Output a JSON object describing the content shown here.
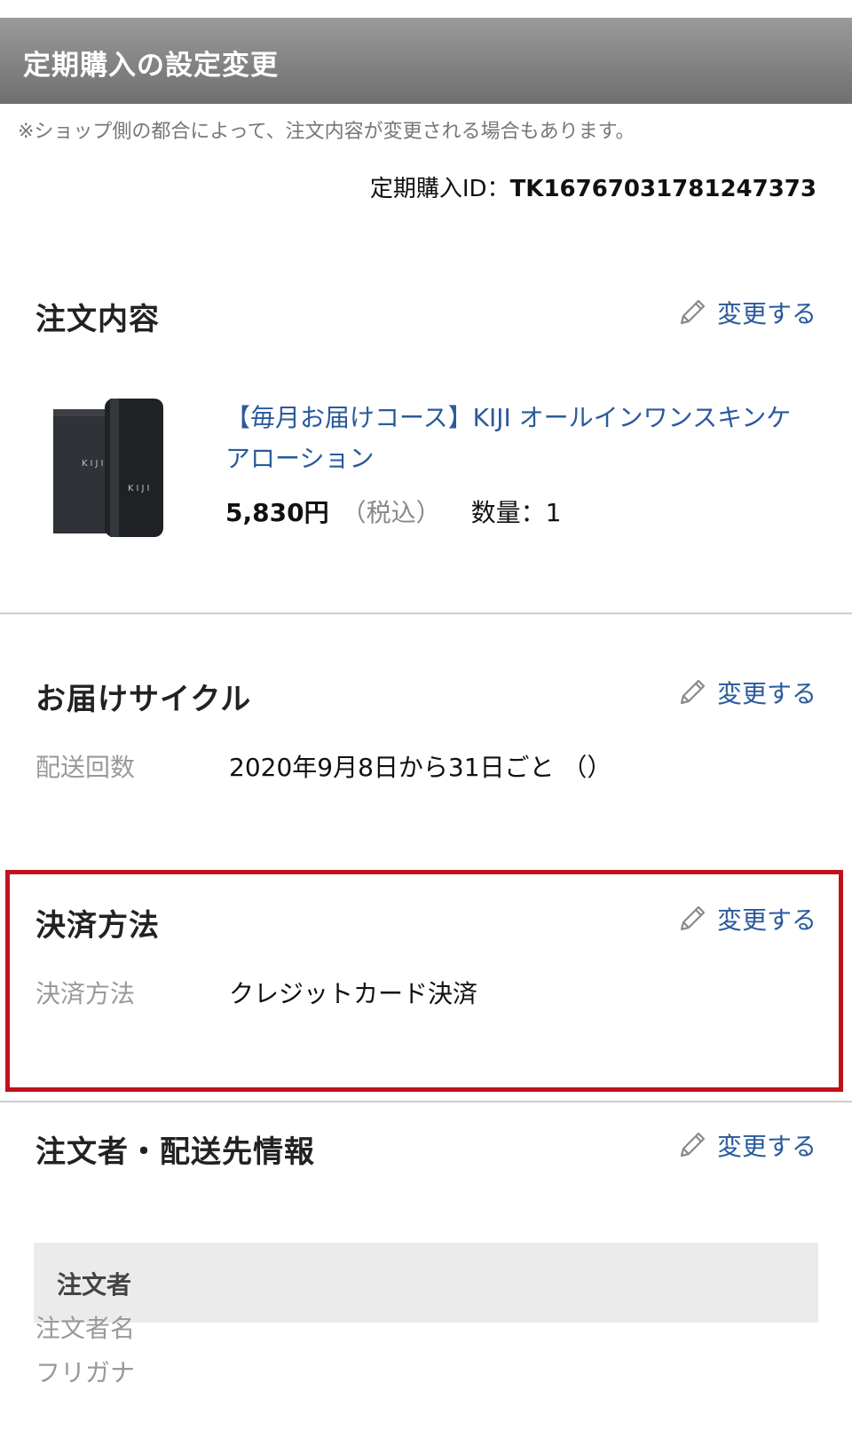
{
  "header": {
    "title": "定期購入の設定変更"
  },
  "notice": "※ショップ側の都合によって、注文内容が変更される場合もあります。",
  "subscription": {
    "id_label": "定期購入ID：",
    "id_value": "TK16767031781247373"
  },
  "change_label": "変更する",
  "order": {
    "title": "注文内容",
    "product": {
      "name": "【毎月お届けコース】KIJI オールインワンスキンケアローション",
      "brand_text": "KIJI",
      "price": "5,830円",
      "tax_note": "（税込）",
      "quantity_label": "数量：1"
    }
  },
  "delivery": {
    "title": "お届けサイクル",
    "row_label": "配送回数",
    "row_value": "2020年9月8日から31日ごと （）"
  },
  "payment": {
    "title": "決済方法",
    "row_label": "決済方法",
    "row_value": "クレジットカード決済"
  },
  "customer": {
    "title": "注文者・配送先情報",
    "subheader": "注文者",
    "fields": [
      "注文者名",
      "フリガナ"
    ]
  },
  "colors": {
    "link": "#2a5a9c",
    "highlight_border": "#c0121c",
    "header_bg": "#808080"
  }
}
